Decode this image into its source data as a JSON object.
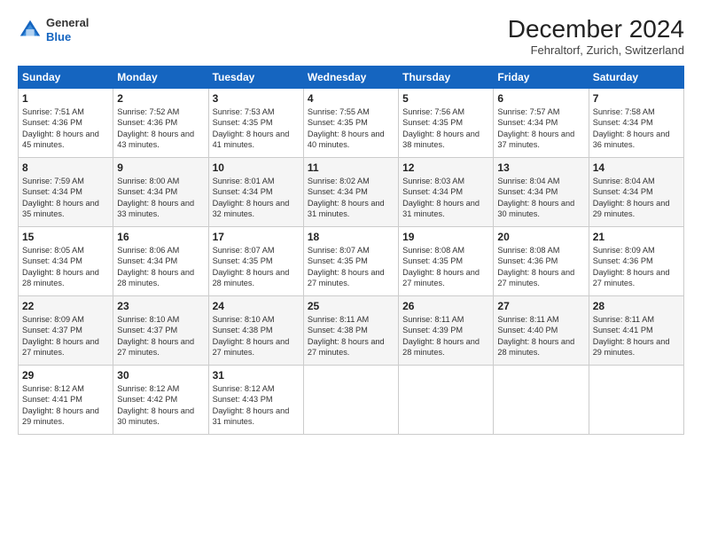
{
  "header": {
    "logo_general": "General",
    "logo_blue": "Blue",
    "month_title": "December 2024",
    "location": "Fehraltorf, Zurich, Switzerland"
  },
  "days_of_week": [
    "Sunday",
    "Monday",
    "Tuesday",
    "Wednesday",
    "Thursday",
    "Friday",
    "Saturday"
  ],
  "weeks": [
    [
      {
        "day": "1",
        "sunrise": "Sunrise: 7:51 AM",
        "sunset": "Sunset: 4:36 PM",
        "daylight": "Daylight: 8 hours and 45 minutes."
      },
      {
        "day": "2",
        "sunrise": "Sunrise: 7:52 AM",
        "sunset": "Sunset: 4:36 PM",
        "daylight": "Daylight: 8 hours and 43 minutes."
      },
      {
        "day": "3",
        "sunrise": "Sunrise: 7:53 AM",
        "sunset": "Sunset: 4:35 PM",
        "daylight": "Daylight: 8 hours and 41 minutes."
      },
      {
        "day": "4",
        "sunrise": "Sunrise: 7:55 AM",
        "sunset": "Sunset: 4:35 PM",
        "daylight": "Daylight: 8 hours and 40 minutes."
      },
      {
        "day": "5",
        "sunrise": "Sunrise: 7:56 AM",
        "sunset": "Sunset: 4:35 PM",
        "daylight": "Daylight: 8 hours and 38 minutes."
      },
      {
        "day": "6",
        "sunrise": "Sunrise: 7:57 AM",
        "sunset": "Sunset: 4:34 PM",
        "daylight": "Daylight: 8 hours and 37 minutes."
      },
      {
        "day": "7",
        "sunrise": "Sunrise: 7:58 AM",
        "sunset": "Sunset: 4:34 PM",
        "daylight": "Daylight: 8 hours and 36 minutes."
      }
    ],
    [
      {
        "day": "8",
        "sunrise": "Sunrise: 7:59 AM",
        "sunset": "Sunset: 4:34 PM",
        "daylight": "Daylight: 8 hours and 35 minutes."
      },
      {
        "day": "9",
        "sunrise": "Sunrise: 8:00 AM",
        "sunset": "Sunset: 4:34 PM",
        "daylight": "Daylight: 8 hours and 33 minutes."
      },
      {
        "day": "10",
        "sunrise": "Sunrise: 8:01 AM",
        "sunset": "Sunset: 4:34 PM",
        "daylight": "Daylight: 8 hours and 32 minutes."
      },
      {
        "day": "11",
        "sunrise": "Sunrise: 8:02 AM",
        "sunset": "Sunset: 4:34 PM",
        "daylight": "Daylight: 8 hours and 31 minutes."
      },
      {
        "day": "12",
        "sunrise": "Sunrise: 8:03 AM",
        "sunset": "Sunset: 4:34 PM",
        "daylight": "Daylight: 8 hours and 31 minutes."
      },
      {
        "day": "13",
        "sunrise": "Sunrise: 8:04 AM",
        "sunset": "Sunset: 4:34 PM",
        "daylight": "Daylight: 8 hours and 30 minutes."
      },
      {
        "day": "14",
        "sunrise": "Sunrise: 8:04 AM",
        "sunset": "Sunset: 4:34 PM",
        "daylight": "Daylight: 8 hours and 29 minutes."
      }
    ],
    [
      {
        "day": "15",
        "sunrise": "Sunrise: 8:05 AM",
        "sunset": "Sunset: 4:34 PM",
        "daylight": "Daylight: 8 hours and 28 minutes."
      },
      {
        "day": "16",
        "sunrise": "Sunrise: 8:06 AM",
        "sunset": "Sunset: 4:34 PM",
        "daylight": "Daylight: 8 hours and 28 minutes."
      },
      {
        "day": "17",
        "sunrise": "Sunrise: 8:07 AM",
        "sunset": "Sunset: 4:35 PM",
        "daylight": "Daylight: 8 hours and 28 minutes."
      },
      {
        "day": "18",
        "sunrise": "Sunrise: 8:07 AM",
        "sunset": "Sunset: 4:35 PM",
        "daylight": "Daylight: 8 hours and 27 minutes."
      },
      {
        "day": "19",
        "sunrise": "Sunrise: 8:08 AM",
        "sunset": "Sunset: 4:35 PM",
        "daylight": "Daylight: 8 hours and 27 minutes."
      },
      {
        "day": "20",
        "sunrise": "Sunrise: 8:08 AM",
        "sunset": "Sunset: 4:36 PM",
        "daylight": "Daylight: 8 hours and 27 minutes."
      },
      {
        "day": "21",
        "sunrise": "Sunrise: 8:09 AM",
        "sunset": "Sunset: 4:36 PM",
        "daylight": "Daylight: 8 hours and 27 minutes."
      }
    ],
    [
      {
        "day": "22",
        "sunrise": "Sunrise: 8:09 AM",
        "sunset": "Sunset: 4:37 PM",
        "daylight": "Daylight: 8 hours and 27 minutes."
      },
      {
        "day": "23",
        "sunrise": "Sunrise: 8:10 AM",
        "sunset": "Sunset: 4:37 PM",
        "daylight": "Daylight: 8 hours and 27 minutes."
      },
      {
        "day": "24",
        "sunrise": "Sunrise: 8:10 AM",
        "sunset": "Sunset: 4:38 PM",
        "daylight": "Daylight: 8 hours and 27 minutes."
      },
      {
        "day": "25",
        "sunrise": "Sunrise: 8:11 AM",
        "sunset": "Sunset: 4:38 PM",
        "daylight": "Daylight: 8 hours and 27 minutes."
      },
      {
        "day": "26",
        "sunrise": "Sunrise: 8:11 AM",
        "sunset": "Sunset: 4:39 PM",
        "daylight": "Daylight: 8 hours and 28 minutes."
      },
      {
        "day": "27",
        "sunrise": "Sunrise: 8:11 AM",
        "sunset": "Sunset: 4:40 PM",
        "daylight": "Daylight: 8 hours and 28 minutes."
      },
      {
        "day": "28",
        "sunrise": "Sunrise: 8:11 AM",
        "sunset": "Sunset: 4:41 PM",
        "daylight": "Daylight: 8 hours and 29 minutes."
      }
    ],
    [
      {
        "day": "29",
        "sunrise": "Sunrise: 8:12 AM",
        "sunset": "Sunset: 4:41 PM",
        "daylight": "Daylight: 8 hours and 29 minutes."
      },
      {
        "day": "30",
        "sunrise": "Sunrise: 8:12 AM",
        "sunset": "Sunset: 4:42 PM",
        "daylight": "Daylight: 8 hours and 30 minutes."
      },
      {
        "day": "31",
        "sunrise": "Sunrise: 8:12 AM",
        "sunset": "Sunset: 4:43 PM",
        "daylight": "Daylight: 8 hours and 31 minutes."
      },
      {
        "day": "",
        "sunrise": "",
        "sunset": "",
        "daylight": ""
      },
      {
        "day": "",
        "sunrise": "",
        "sunset": "",
        "daylight": ""
      },
      {
        "day": "",
        "sunrise": "",
        "sunset": "",
        "daylight": ""
      },
      {
        "day": "",
        "sunrise": "",
        "sunset": "",
        "daylight": ""
      }
    ]
  ]
}
